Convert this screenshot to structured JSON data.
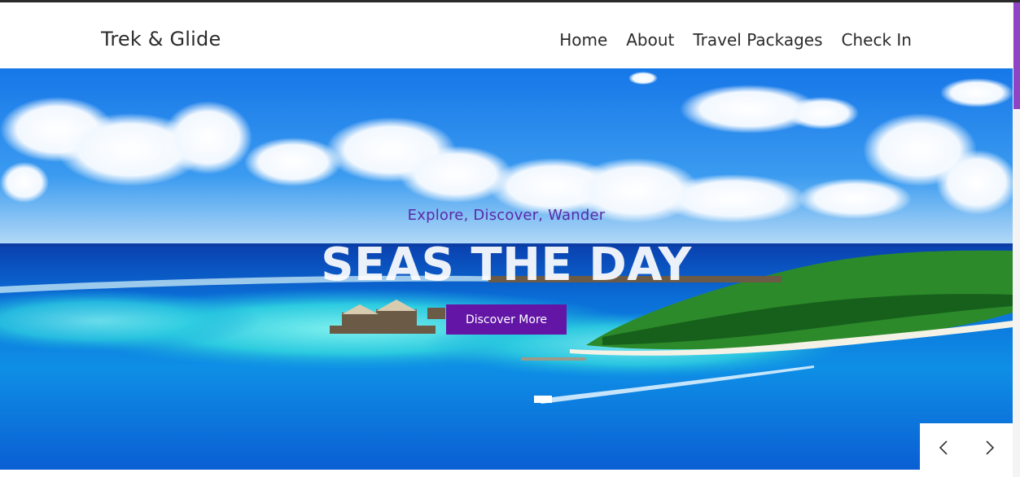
{
  "header": {
    "brand": "Trek & Glide",
    "nav": [
      "Home",
      "About",
      "Travel Packages",
      "Check In"
    ]
  },
  "hero": {
    "subtitle": "Explore, Discover, Wander",
    "title": "SEAS THE DAY",
    "cta_label": "Discover More"
  },
  "slider": {
    "prev_icon": "chevron-left-icon",
    "next_icon": "chevron-right-icon"
  },
  "colors": {
    "accent": "#6316a6",
    "subtitle": "#5a2aa8",
    "scrollbar_thumb": "#8e44c4"
  }
}
